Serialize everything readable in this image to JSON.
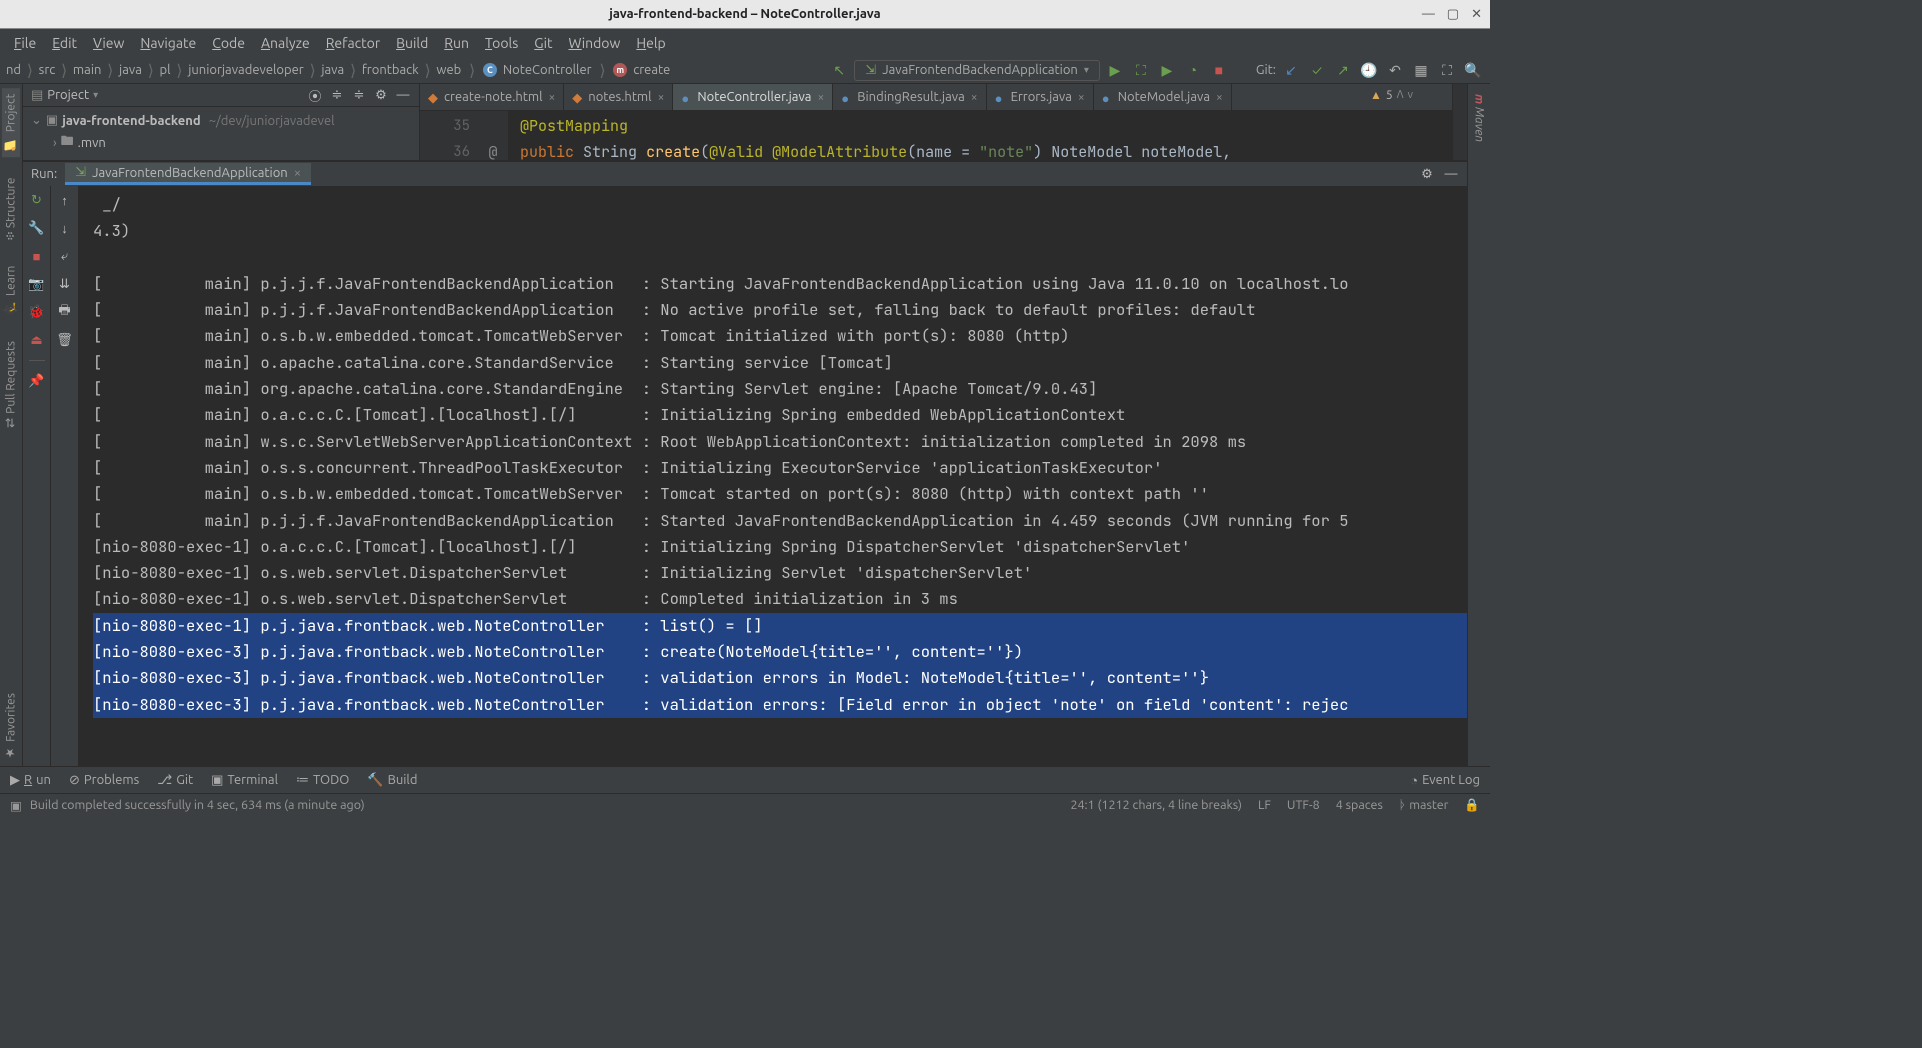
{
  "window_title": "java-frontend-backend – NoteController.java",
  "menu": [
    "File",
    "Edit",
    "View",
    "Navigate",
    "Code",
    "Analyze",
    "Refactor",
    "Build",
    "Run",
    "Tools",
    "Git",
    "Window",
    "Help"
  ],
  "breadcrumbs": [
    "nd",
    "src",
    "main",
    "java",
    "pl",
    "juniorjavadeveloper",
    "java",
    "frontback",
    "web"
  ],
  "breadcrumb_class": "NoteController",
  "breadcrumb_method": "create",
  "run_config": "JavaFrontendBackendApplication",
  "git_label": "Git:",
  "project_tool": {
    "title": "Project",
    "root": "java-frontend-backend",
    "root_path": "~/dev/juniorjavadevel",
    "child": ".mvn"
  },
  "editor_tabs": [
    {
      "label": "create-note.html",
      "type": "html",
      "active": false
    },
    {
      "label": "notes.html",
      "type": "html",
      "active": false
    },
    {
      "label": "NoteController.java",
      "type": "java",
      "active": true
    },
    {
      "label": "BindingResult.java",
      "type": "java",
      "active": false
    },
    {
      "label": "Errors.java",
      "type": "java",
      "active": false
    },
    {
      "label": "NoteModel.java",
      "type": "java",
      "active": false
    }
  ],
  "code": {
    "line35_num": "35",
    "line36_num": "36",
    "annotation": "@PostMapping",
    "kw_public": "public",
    "type_string": "String",
    "method": "create",
    "ann_valid": "@Valid",
    "ann_model": "@ModelAttribute",
    "name_eq": "name = ",
    "str_note": "\"note\"",
    "type_model": "NoteModel",
    "param": "noteModel",
    "gutter_icon": "@"
  },
  "warnings": "5",
  "run_label": "Run:",
  "run_tab": "JavaFrontendBackendApplication",
  "console_top1": " _/",
  "console_top2": "4.3)",
  "log_lines": [
    "[           main] p.j.j.f.JavaFrontendBackendApplication   : Starting JavaFrontendBackendApplication using Java 11.0.10 on localhost.lo",
    "[           main] p.j.j.f.JavaFrontendBackendApplication   : No active profile set, falling back to default profiles: default",
    "[           main] o.s.b.w.embedded.tomcat.TomcatWebServer  : Tomcat initialized with port(s): 8080 (http)",
    "[           main] o.apache.catalina.core.StandardService   : Starting service [Tomcat]",
    "[           main] org.apache.catalina.core.StandardEngine  : Starting Servlet engine: [Apache Tomcat/9.0.43]",
    "[           main] o.a.c.c.C.[Tomcat].[localhost].[/]       : Initializing Spring embedded WebApplicationContext",
    "[           main] w.s.c.ServletWebServerApplicationContext : Root WebApplicationContext: initialization completed in 2098 ms",
    "[           main] o.s.s.concurrent.ThreadPoolTaskExecutor  : Initializing ExecutorService 'applicationTaskExecutor'",
    "[           main] o.s.b.w.embedded.tomcat.TomcatWebServer  : Tomcat started on port(s): 8080 (http) with context path ''",
    "[           main] p.j.j.f.JavaFrontendBackendApplication   : Started JavaFrontendBackendApplication in 4.459 seconds (JVM running for 5",
    "[nio-8080-exec-1] o.a.c.c.C.[Tomcat].[localhost].[/]       : Initializing Spring DispatcherServlet 'dispatcherServlet'",
    "[nio-8080-exec-1] o.s.web.servlet.DispatcherServlet        : Initializing Servlet 'dispatcherServlet'",
    "[nio-8080-exec-1] o.s.web.servlet.DispatcherServlet        : Completed initialization in 3 ms"
  ],
  "log_selected": [
    "[nio-8080-exec-1] p.j.java.frontback.web.NoteController    : list() = []",
    "[nio-8080-exec-3] p.j.java.frontback.web.NoteController    : create(NoteModel{title='', content=''})",
    "[nio-8080-exec-3] p.j.java.frontback.web.NoteController    : validation errors in Model: NoteModel{title='', content=''}",
    "[nio-8080-exec-3] p.j.java.frontback.web.NoteController    : validation errors: [Field error in object 'note' on field 'content': rejec"
  ],
  "left_tabs": [
    "Project",
    "Structure",
    "Learn",
    "Pull Requests",
    "Favorites"
  ],
  "right_tab": "Maven",
  "bottom_tabs": [
    {
      "icon": "▶",
      "label": "Run",
      "u": true
    },
    {
      "icon": "⊘",
      "label": "Problems"
    },
    {
      "icon": "⎇",
      "label": "Git"
    },
    {
      "icon": "▣",
      "label": "Terminal"
    },
    {
      "icon": "≔",
      "label": "TODO"
    },
    {
      "icon": "🔨",
      "label": "Build"
    }
  ],
  "event_log": "Event Log",
  "status_msg": "Build completed successfully in 4 sec, 634 ms (a minute ago)",
  "status_right": {
    "pos": "24:1 (1212 chars, 4 line breaks)",
    "eol": "LF",
    "enc": "UTF-8",
    "indent": "4 spaces",
    "branch": "master"
  }
}
